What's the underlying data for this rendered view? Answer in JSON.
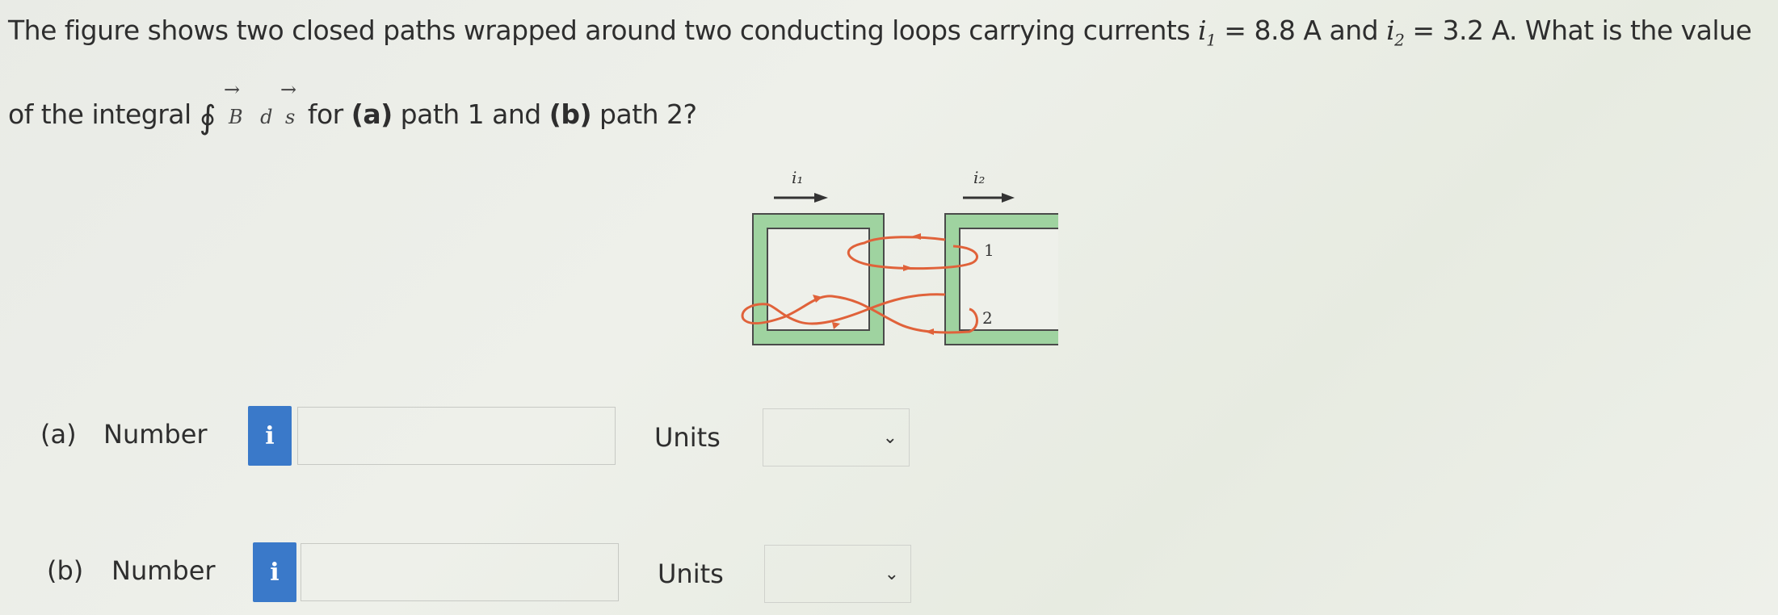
{
  "question": {
    "line1_prefix": "The figure shows two closed paths wrapped around two conducting loops carrying currents ",
    "i1_symbol": "i",
    "i1_sub": "1",
    "i1_value": " = 8.8 A and ",
    "i2_symbol": "i",
    "i2_sub": "2",
    "i2_value": " = 3.2 A. What is the value",
    "line2_prefix": "of the integral ",
    "integral_symbol": "∮",
    "vec_B": "B",
    "vec_d": "d",
    "vec_s": "s",
    "arrow": "→",
    "line2_suffix_pre": "for ",
    "part_a_tag": "(a)",
    "line2_mid": " path 1 and ",
    "part_b_tag": "(b)",
    "line2_end": " path 2?"
  },
  "figure": {
    "current1_label": "i₁",
    "current2_label": "i₂",
    "path1_label": "1",
    "path2_label": "2",
    "colors": {
      "loop_fill": "#9fd3a0",
      "loop_edge": "#4a4a4a",
      "path": "#e0623a"
    }
  },
  "parts": [
    {
      "tag": "(a)",
      "number_label": "Number",
      "info_icon": "i",
      "number_value": "",
      "units_label": "Units",
      "units_value": ""
    },
    {
      "tag": "(b)",
      "number_label": "Number",
      "info_icon": "i",
      "number_value": "",
      "units_label": "Units",
      "units_value": ""
    }
  ],
  "chevron": "⌄"
}
